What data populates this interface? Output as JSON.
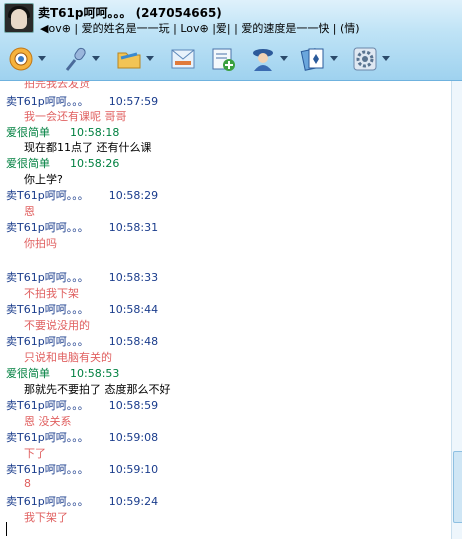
{
  "window": {
    "contact_name": "卖T61p呵呵。。。",
    "contact_qq": "(247054665)",
    "signature": "◀ov⊕ | 爱的姓名是一一玩   | Lov⊕  |爱|  | 爱的速度是一一快   |  (情)"
  },
  "toolbar": {
    "buttons": [
      {
        "name": "video-chat",
        "icon": "webcam-icon",
        "color": "#f0a030"
      },
      {
        "name": "voice-chat",
        "icon": "microphone-icon",
        "color": "#6a8fc0"
      },
      {
        "name": "send-file",
        "icon": "folder-icon",
        "color": "#e8b040"
      },
      {
        "name": "send-mail",
        "icon": "mail-icon",
        "color": "#7aa8d8"
      },
      {
        "name": "create-group",
        "icon": "add-contact-icon",
        "color": "#3aa040"
      },
      {
        "name": "remote-assist",
        "icon": "user-icon",
        "color": "#3a6ab0"
      },
      {
        "name": "game",
        "icon": "cards-icon",
        "color": "#5090d0"
      },
      {
        "name": "applications",
        "icon": "gear-icon",
        "color": "#7a8fa8"
      }
    ]
  },
  "chat": {
    "partial_top": "拍完我去发货",
    "messages": [
      {
        "sender": "卖T61p呵呵。。。",
        "time": "10:57:59",
        "text": "我一会还有课呢 哥哥",
        "who": "other"
      },
      {
        "sender": "爱很简单",
        "time": "10:58:18",
        "text": "现在都11点了   还有什么课",
        "who": "self"
      },
      {
        "sender": "爱很简单",
        "time": "10:58:26",
        "text": "你上学?",
        "who": "self"
      },
      {
        "sender": "卖T61p呵呵。。。",
        "time": "10:58:29",
        "text": "恩",
        "who": "other"
      },
      {
        "sender": "卖T61p呵呵。。。",
        "time": "10:58:31",
        "text": "你拍吗",
        "who": "other"
      },
      {
        "sender": "卖T61p呵呵。。。",
        "time": "10:58:33",
        "text": "不拍我下架",
        "who": "other"
      },
      {
        "sender": "卖T61p呵呵。。。",
        "time": "10:58:44",
        "text": "不要说没用的",
        "who": "other"
      },
      {
        "sender": "卖T61p呵呵。。。",
        "time": "10:58:48",
        "text": "只说和电脑有关的",
        "who": "other"
      },
      {
        "sender": "爱很简单",
        "time": "10:58:53",
        "text": "那就先不要拍了     态度那么不好",
        "who": "self"
      },
      {
        "sender": "卖T61p呵呵。。。",
        "time": "10:58:59",
        "text": "恩 没关系",
        "who": "other"
      },
      {
        "sender": "卖T61p呵呵。。。",
        "time": "10:59:08",
        "text": "下了",
        "who": "other"
      },
      {
        "sender": "卖T61p呵呵。。。",
        "time": "10:59:10",
        "text": "8",
        "who": "other"
      },
      {
        "sender": "卖T61p呵呵。。。",
        "time": "10:59:24",
        "text": "我下架了",
        "who": "other"
      }
    ]
  }
}
